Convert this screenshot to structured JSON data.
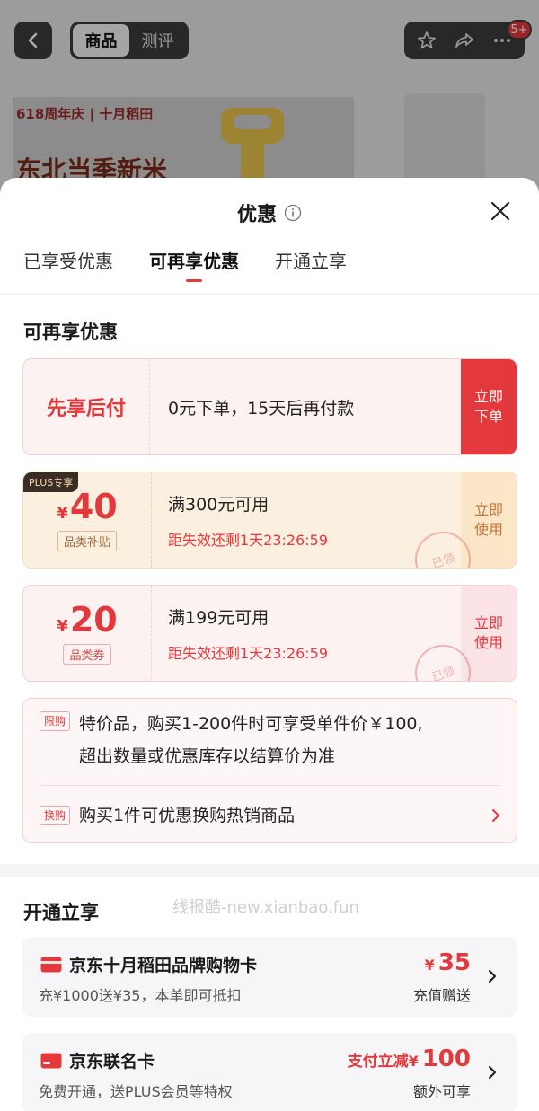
{
  "bg": {
    "tabs": [
      "商品",
      "测评"
    ],
    "badge": "5+",
    "brand_text": "618周年庆 | 十月稻田",
    "slogan": "东北当季新米"
  },
  "sheet": {
    "title": "优惠",
    "tabs": [
      "已享受优惠",
      "可再享优惠",
      "开通立享"
    ],
    "active_tab": 1,
    "section_title": "可再享优惠"
  },
  "cards": {
    "pay_later": {
      "label": "先享后付",
      "desc": "0元下单，15天后再付款",
      "action": "立即下单"
    },
    "coupon_plus": {
      "badge": "PLUS专享",
      "currency": "¥",
      "amount": "40",
      "kind": "品类补贴",
      "condition": "满300元可用",
      "expire": "距失效还剩1天23:26:59",
      "stamp": "已领",
      "action": "立即使用"
    },
    "coupon_cat": {
      "currency": "¥",
      "amount": "20",
      "kind": "品类券",
      "condition": "满199元可用",
      "expire": "距失效还剩1天23:26:59",
      "stamp": "已领",
      "action": "立即使用"
    }
  },
  "promos": {
    "limit": {
      "tag": "限购",
      "text_line1": "特价品，购买1-200件时可享受单件价￥100,",
      "text_line2": "超出数量或优惠库存以结算价为准"
    },
    "swap": {
      "tag": "换购",
      "text": "购买1件可优惠换购热销商品"
    }
  },
  "open_section": {
    "title": "开通立享",
    "watermark": "线报酷-new.xianbao.fun",
    "items": [
      {
        "name": "京东十月稻田品牌购物卡",
        "desc": "充¥1000送¥35，本单即可抵扣",
        "value_currency": "¥",
        "value": "35",
        "sub": "充值赠送"
      },
      {
        "name": "京东联名卡",
        "desc": "免费开通，送PLUS会员等特权",
        "value_prefix": "支付立减",
        "value_currency": "¥",
        "value": "100",
        "sub": "额外可享"
      }
    ]
  },
  "colors": {
    "accent": "#e4393c",
    "gold": "#c2783a"
  }
}
